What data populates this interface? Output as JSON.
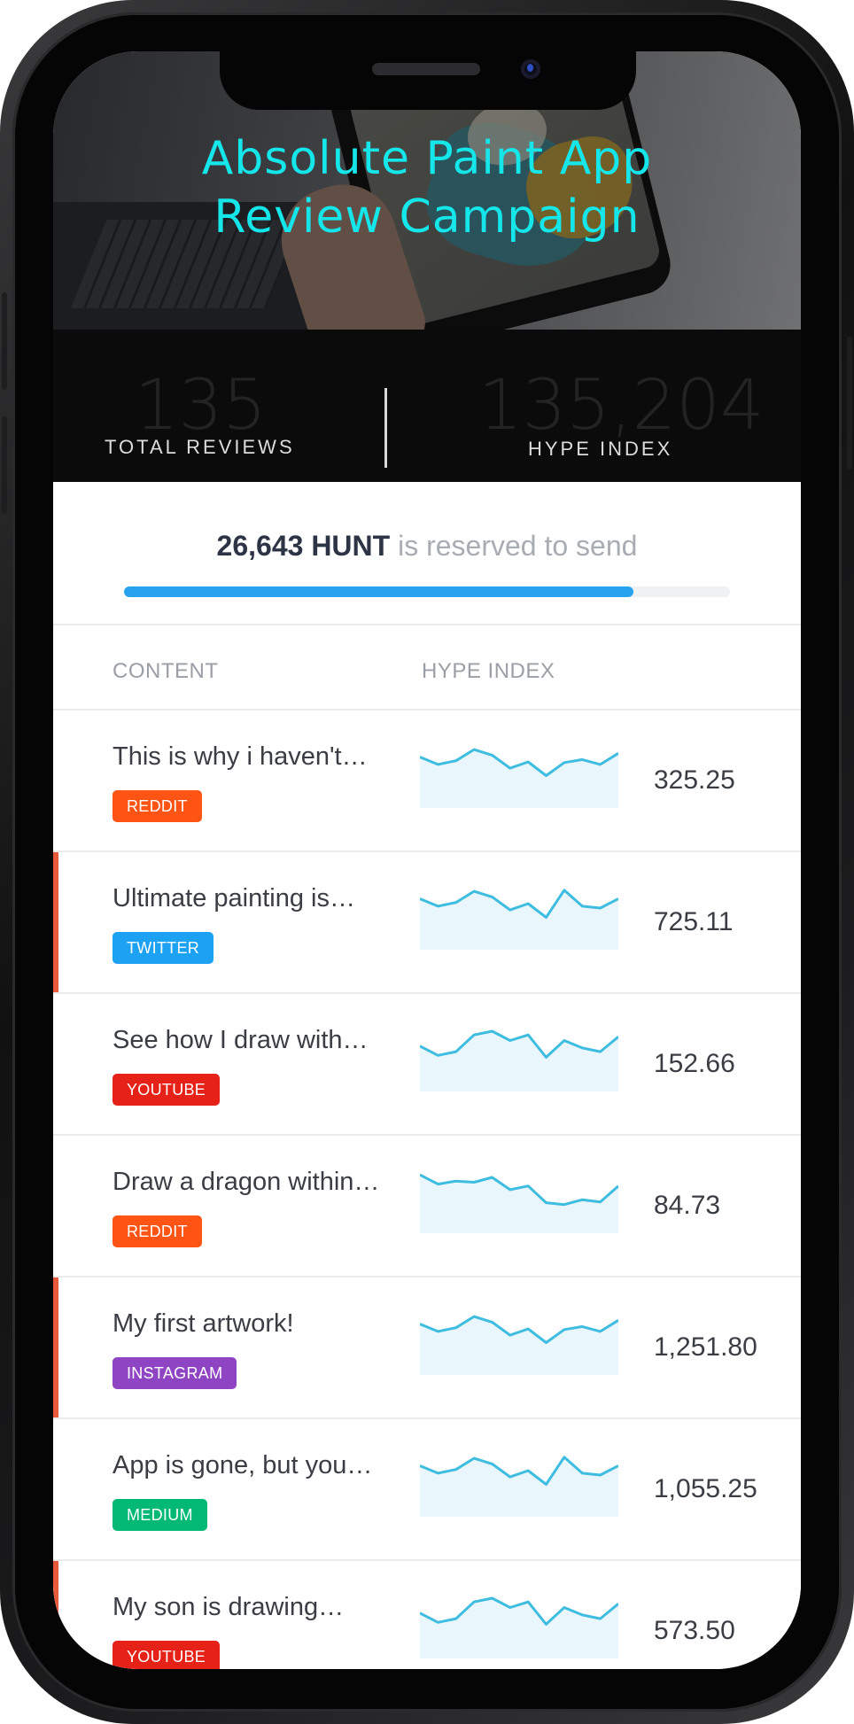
{
  "campaign": {
    "title_line1": "Absolute Paint App",
    "title_line2": "Review Campaign"
  },
  "stats": {
    "total_reviews_value": "135",
    "total_reviews_label": "TOTAL REVIEWS",
    "hype_index_value": "135,204",
    "hype_index_label": "HYPE INDEX"
  },
  "reserve": {
    "amount": "26,643 HUNT",
    "text": "is reserved to send",
    "progress": 0.84,
    "progress_color": "#27a3ee"
  },
  "table": {
    "headers": {
      "content": "CONTENT",
      "hype_index": "HYPE INDEX"
    },
    "rows": [
      {
        "title": "This is why i haven't…",
        "platform": "REDDIT",
        "badge_color": "#ff5414",
        "value": "325.25",
        "flagged": false,
        "spark": [
          0.25,
          0.45,
          0.35,
          0.05,
          0.2,
          0.55,
          0.38,
          0.75,
          0.4,
          0.32,
          0.45,
          0.15
        ]
      },
      {
        "title": "Ultimate painting is…",
        "platform": "TWITTER",
        "badge_color": "#1da1f2",
        "value": "725.11",
        "flagged": true,
        "spark": [
          0.25,
          0.45,
          0.35,
          0.05,
          0.2,
          0.55,
          0.38,
          0.75,
          0.02,
          0.45,
          0.5,
          0.25
        ]
      },
      {
        "title": "See how I draw with…",
        "platform": "YOUTUBE",
        "badge_color": "#e62117",
        "value": "152.66",
        "flagged": false,
        "spark": [
          0.4,
          0.65,
          0.55,
          0.1,
          0.0,
          0.25,
          0.1,
          0.7,
          0.25,
          0.45,
          0.55,
          0.15
        ]
      },
      {
        "title": "Draw a dragon within…",
        "platform": "REDDIT",
        "badge_color": "#ff5414",
        "value": "84.73",
        "flagged": false,
        "spark": [
          0.05,
          0.3,
          0.22,
          0.25,
          0.12,
          0.45,
          0.35,
          0.8,
          0.85,
          0.72,
          0.78,
          0.35
        ]
      },
      {
        "title": "My first artwork!",
        "platform": "INSTAGRAM",
        "badge_color": "#8f44c4",
        "value": "1,251.80",
        "flagged": true,
        "spark": [
          0.25,
          0.45,
          0.35,
          0.05,
          0.2,
          0.55,
          0.38,
          0.75,
          0.4,
          0.32,
          0.45,
          0.15
        ]
      },
      {
        "title": "App is gone, but you…",
        "platform": "MEDIUM",
        "badge_color": "#02b875",
        "value": "1,055.25",
        "flagged": false,
        "spark": [
          0.25,
          0.45,
          0.35,
          0.05,
          0.2,
          0.55,
          0.38,
          0.75,
          0.02,
          0.45,
          0.5,
          0.25
        ]
      },
      {
        "title": "My son is drawing…",
        "platform": "YOUTUBE",
        "badge_color": "#e62117",
        "value": "573.50",
        "flagged": true,
        "spark": [
          0.4,
          0.65,
          0.55,
          0.1,
          0.0,
          0.25,
          0.1,
          0.7,
          0.25,
          0.45,
          0.55,
          0.15
        ]
      }
    ]
  },
  "colors": {
    "title_cyan": "#14e6ea",
    "flag_accent": "#e85a3a",
    "spark_line": "#3ebde0",
    "spark_fill": "#e9f7fc"
  }
}
